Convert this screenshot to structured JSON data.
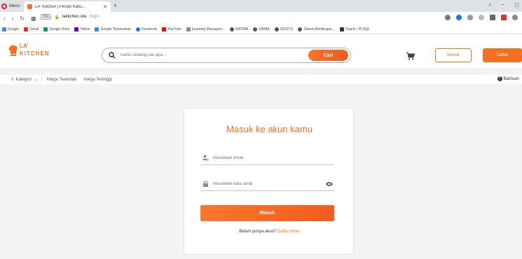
{
  "browser": {
    "menu_label": "Menu",
    "tab_title": "LA' Kitchen | Pesan Katu...",
    "url_host": "lakitchen.site",
    "url_path": "/login",
    "bookmarks": [
      "Google",
      "Gmail",
      "Google Drive",
      "Yahoo",
      "Google Terjemahan",
      "Facebook",
      "YouTube",
      "Learning Managem...",
      "SIATMA",
      "SIKMA",
      "SIOSTU",
      "Sistem Bimbingan...",
      "Oracle / PLSQL"
    ]
  },
  "header": {
    "logo_top": "LA'",
    "logo_bottom": "KITCHEN",
    "search_placeholder": "Kamu sedang cari apa...",
    "search_button": "Cari",
    "login_button": "Masuk",
    "register_button": "Daftar"
  },
  "subnav": {
    "category": "Kategori",
    "links": [
      "Harga Terendah",
      "Harga Tertinggi"
    ],
    "help": "Bantuan"
  },
  "login": {
    "title": "Masuk ke akun kamu",
    "email_placeholder": "Masukkan email",
    "password_placeholder": "Masukkan kata sandi",
    "submit": "Masuk",
    "register_prompt": "Belum punya akun?",
    "register_link": "Daftar disini"
  },
  "colors": {
    "accent": "#f37021",
    "page_bg": "#f3f3f3"
  }
}
